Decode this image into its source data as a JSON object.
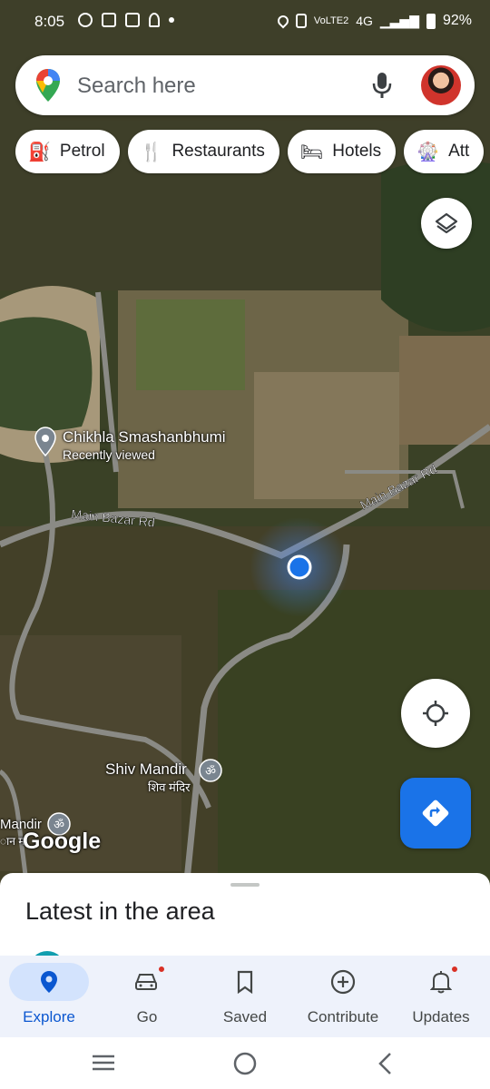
{
  "status_bar": {
    "time": "8:05",
    "network_label": "VoLTE2",
    "network_type": "4G",
    "battery": "92%"
  },
  "search": {
    "placeholder": "Search here",
    "mic_icon": "microphone-icon",
    "avatar_icon": "user-avatar"
  },
  "chips": [
    {
      "label": "Petrol",
      "icon": "gas-station-icon"
    },
    {
      "label": "Restaurants",
      "icon": "restaurant-icon"
    },
    {
      "label": "Hotels",
      "icon": "hotel-bed-icon"
    },
    {
      "label": "Att",
      "icon": "attractions-icon"
    }
  ],
  "map": {
    "poi1": {
      "name": "Chikhla Smashanbhumi",
      "sub": "Recently viewed"
    },
    "road_label_1": "Main Bazar Rd",
    "road_label_2": "Main Bazar Rd",
    "poi2": {
      "name": "Shiv Mandir",
      "sub": "शिव मंदिर"
    },
    "poi3": {
      "name": "Mandir",
      "sub": "ान म"
    },
    "watermark": "Google"
  },
  "sheet": {
    "heading": "Latest in the area"
  },
  "nav": {
    "items": [
      {
        "label": "Explore",
        "icon": "explore-pin-icon",
        "active": true
      },
      {
        "label": "Go",
        "icon": "car-icon",
        "badge": true
      },
      {
        "label": "Saved",
        "icon": "bookmark-icon"
      },
      {
        "label": "Contribute",
        "icon": "add-circle-icon"
      },
      {
        "label": "Updates",
        "icon": "bell-icon",
        "badge": true
      }
    ]
  },
  "colors": {
    "accent": "#1a73e8",
    "active_nav": "#0b57d0",
    "badge": "#d93025"
  }
}
